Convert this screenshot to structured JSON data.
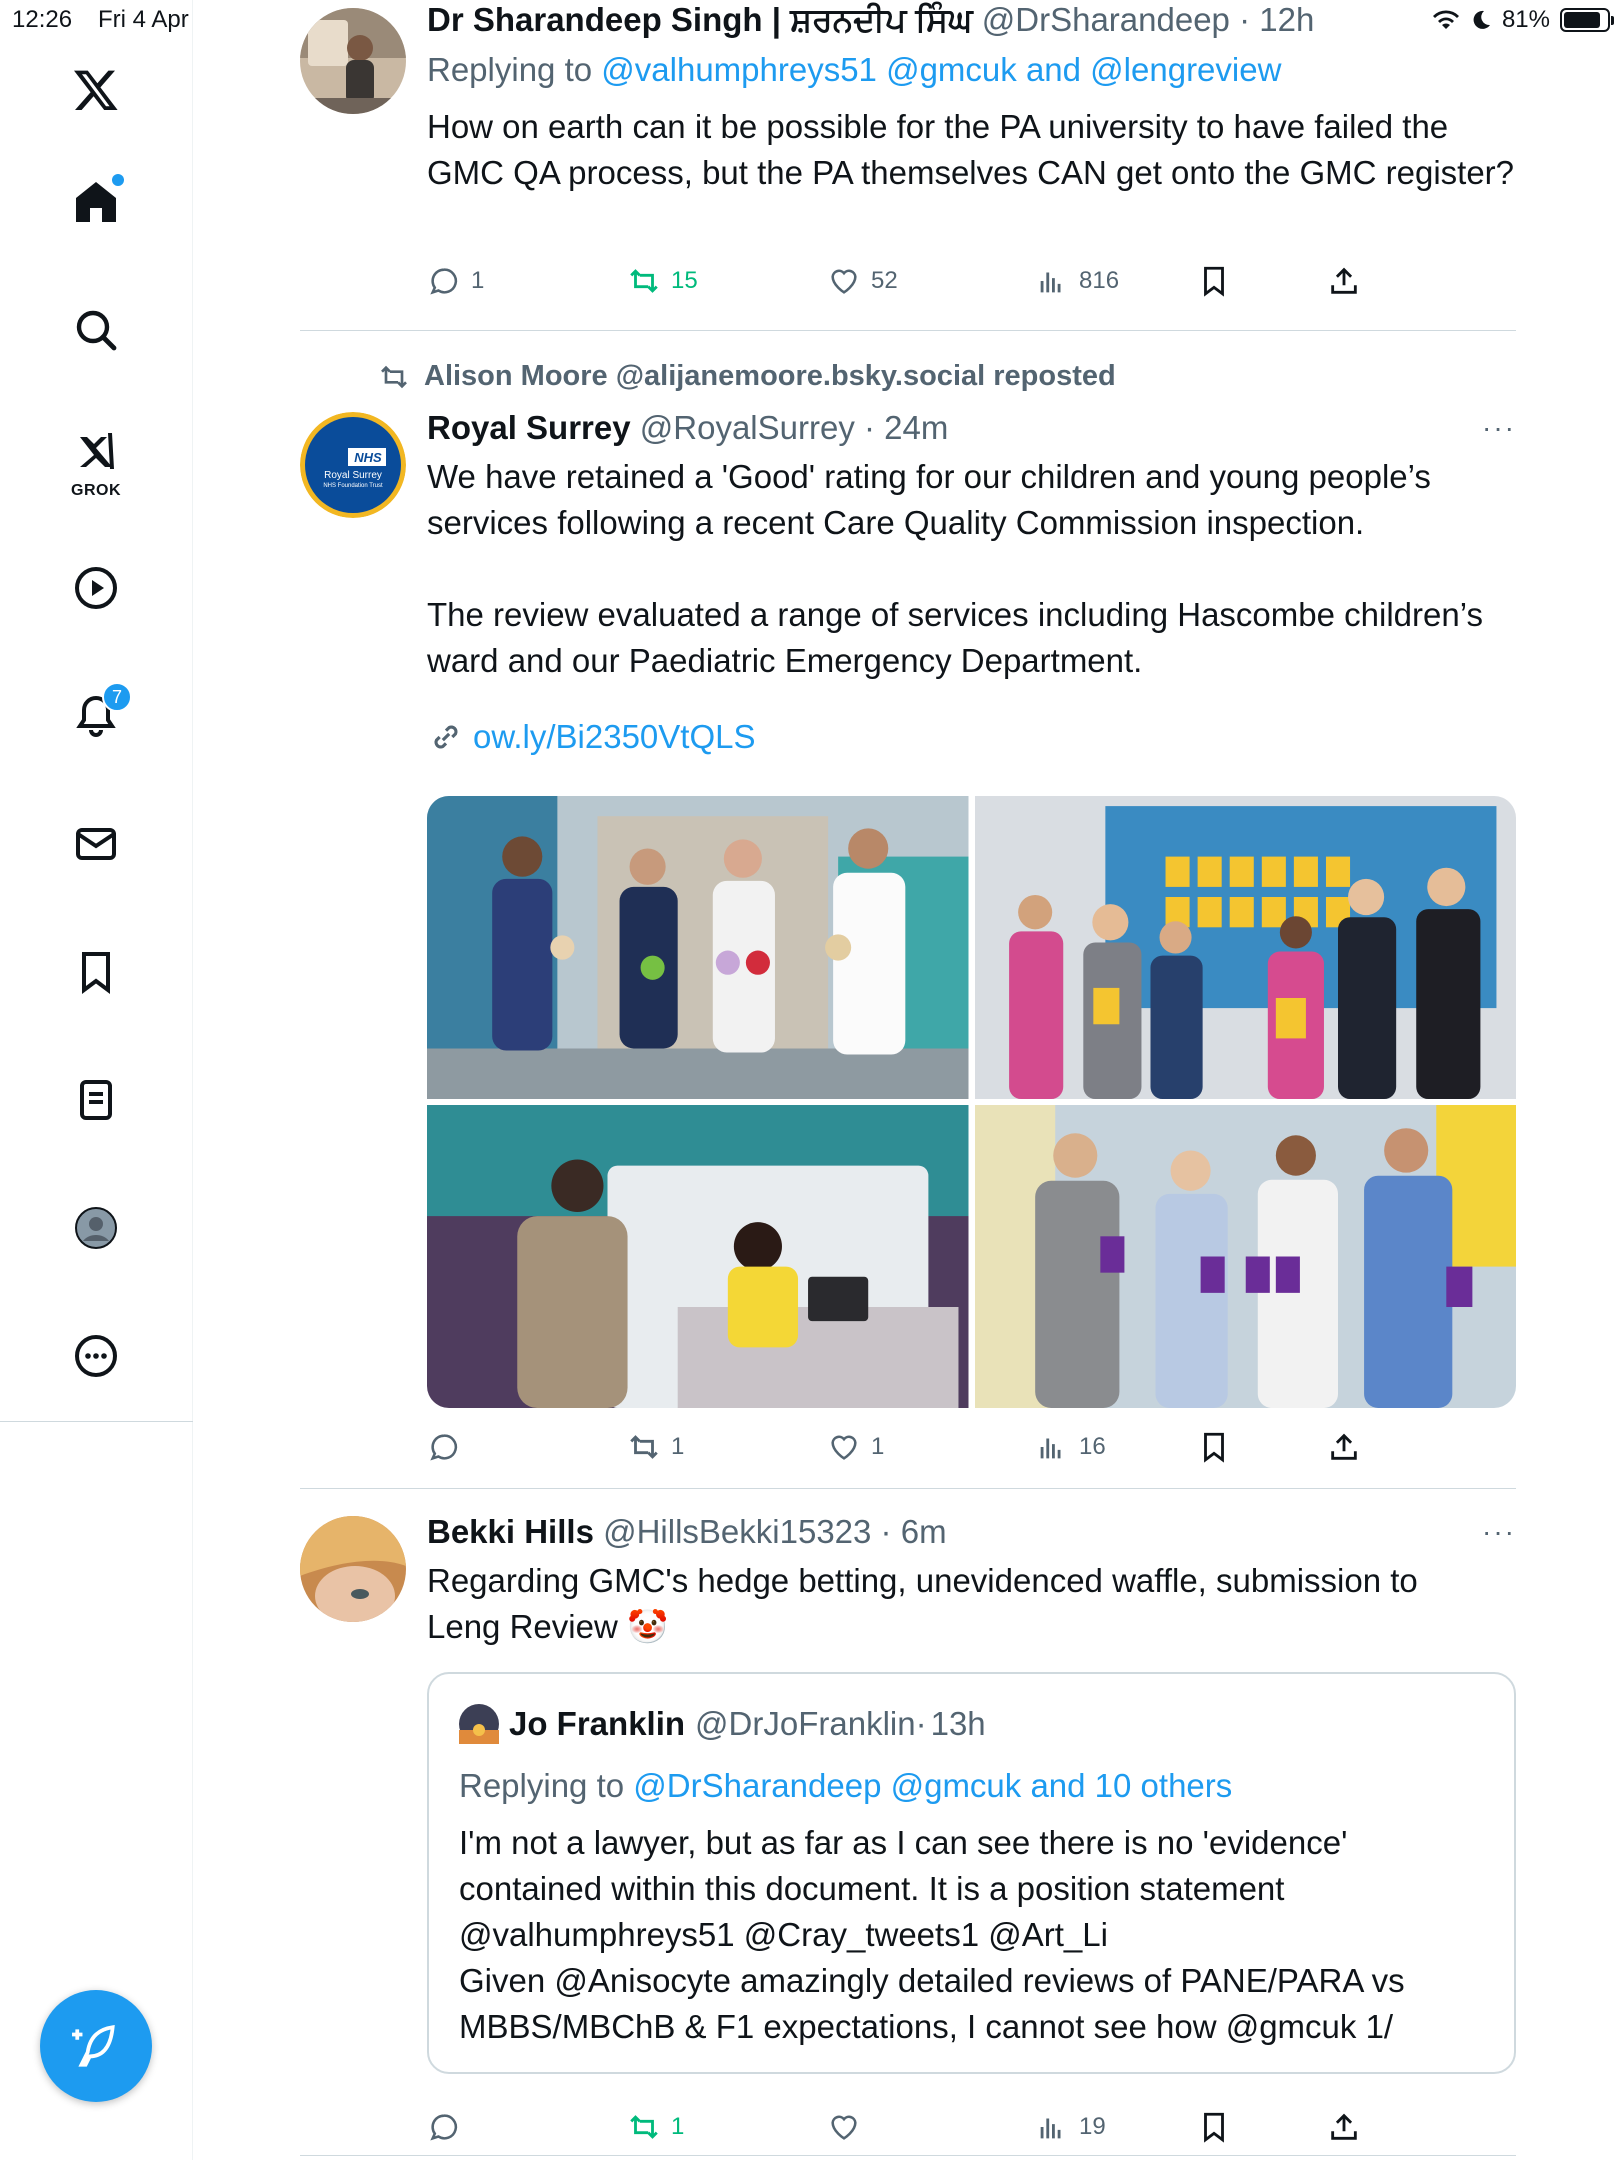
{
  "status_bar": {
    "time": "12:26",
    "date": "Fri 4 Apr",
    "battery": "81%"
  },
  "sidebar": {
    "grok_label": "GROK",
    "notifications_badge": "7",
    "items": [
      "x-logo",
      "home",
      "search",
      "grok",
      "video",
      "notifications",
      "messages",
      "bookmarks",
      "lists",
      "profile",
      "more"
    ]
  },
  "tweets": [
    {
      "name": "Dr Sharandeep Singh | ਸ਼ਰਨਦੀਪ ਸਿੰਘ",
      "handle": "@DrSharandeep",
      "time": "12h",
      "replying_prefix": "Replying to",
      "replying_to": "@valhumphreys51 @gmcuk and @lengreview",
      "text": "How on earth can it be possible for the PA university to have failed the GMC QA process, but the PA themselves CAN get onto the GMC register?",
      "replies": "1",
      "reposts": "15",
      "likes": "52",
      "views": "816"
    },
    {
      "repost_by": "Alison Moore @alijanemoore.bsky.social reposted",
      "name": "Royal Surrey",
      "handle": "@RoyalSurrey",
      "time": "24m",
      "avatar_text_1": "NHS",
      "avatar_text_2": "Royal Surrey",
      "avatar_text_3": "NHS Foundation Trust",
      "text": "We have retained a 'Good' rating for our children and young people’s services following a recent Care Quality Commission inspection.\n\nThe review evaluated a range of services including Hascombe children’s ward and our Paediatric Emergency Department.",
      "link": "ow.ly/Bi2350VtQLS",
      "replies": "",
      "reposts": "1",
      "likes": "1",
      "views": "16"
    },
    {
      "name": "Bekki Hills",
      "handle": "@HillsBekki15323",
      "time": "6m",
      "text": "Regarding GMC's hedge betting, unevidenced waffle, submission to Leng Review 🤡",
      "quote": {
        "name": "Jo Franklin",
        "handle": "@DrJoFranklin",
        "time": "13h",
        "replying_prefix": "Replying to",
        "replying_to": "@DrSharandeep @gmcuk and 10 others",
        "text": "I'm not a lawyer, but as far as I can see there is no 'evidence' contained within this document. It is a position statement\n@valhumphreys51 @Cray_tweets1 @Art_Li\nGiven @Anisocyte amazingly detailed reviews of PANE/PARA vs MBBS/MBChB & F1 expectations, I cannot see how @gmcuk 1/"
      },
      "replies": "",
      "reposts": "1",
      "likes": "",
      "views": "19"
    }
  ],
  "colors": {
    "accent": "#1d9bf0",
    "repost_green": "#00ba7c",
    "secondary_text": "#536471",
    "divider": "#cfd9de"
  }
}
